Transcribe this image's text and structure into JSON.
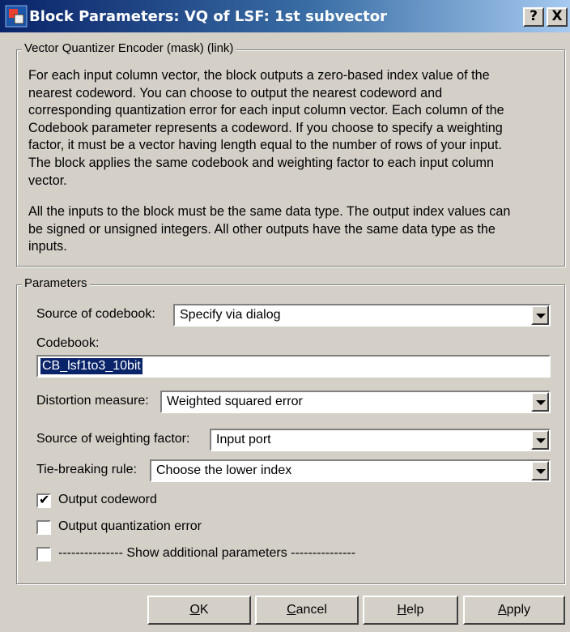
{
  "window": {
    "title": "Block Parameters: VQ of LSF: 1st subvector",
    "help_button": "?",
    "close_button": "X"
  },
  "description_group": {
    "legend": "Vector Quantizer Encoder (mask) (link)",
    "paragraph1_lines": [
      "For each input column vector, the block outputs a zero-based index value of the",
      "nearest codeword. You can choose to output the nearest codeword and",
      "corresponding quantization error for each input column vector. Each column of the",
      "Codebook parameter represents a codeword. If you choose to specify a weighting",
      "factor, it must be a vector having length equal to the number of rows of your input.",
      "The block applies the same codebook and weighting factor to each input column",
      "vector."
    ],
    "paragraph2_lines": [
      "All the inputs to the block must be the same data type. The output index values can",
      "be signed or unsigned integers. All other outputs have the same data type as the",
      "inputs."
    ]
  },
  "parameters": {
    "legend": "Parameters",
    "source_of_codebook": {
      "label": "Source of codebook:",
      "value": "Specify via dialog"
    },
    "codebook": {
      "label": "Codebook:",
      "value": "CB_lsf1to3_10bit"
    },
    "distortion_measure": {
      "label": "Distortion measure:",
      "value": "Weighted squared error"
    },
    "source_of_weighting_factor": {
      "label": "Source of weighting factor:",
      "value": "Input port"
    },
    "tie_breaking_rule": {
      "label": "Tie-breaking rule:",
      "value": "Choose the lower index"
    },
    "output_codeword": {
      "label": "Output codeword",
      "checked": true
    },
    "output_quantization_error": {
      "label": "Output quantization error",
      "checked": false
    },
    "show_additional": {
      "label": "--------------- Show additional parameters ---------------",
      "checked": false
    }
  },
  "buttons": {
    "ok_mnemonic": "O",
    "ok_rest": "K",
    "cancel_mnemonic": "C",
    "cancel_rest": "ancel",
    "help_mnemonic": "H",
    "help_rest": "elp",
    "apply_mnemonic": "A",
    "apply_rest": "pply"
  }
}
